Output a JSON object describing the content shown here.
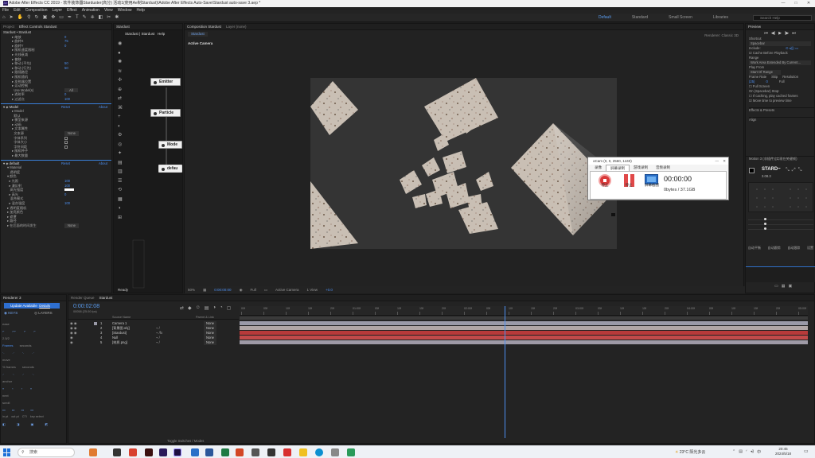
{
  "window": {
    "title": "Adobe After Effects CC 2019 - 软件装饰器Starduster(高分) 活动1(使用Ae制Stardust)\\Adobe After Effects Auto-Save\\Stardust auto-save 3.aep *",
    "controls": [
      "—",
      "□",
      "✕"
    ]
  },
  "menu": [
    "File",
    "Edit",
    "Composition",
    "Layer",
    "Effect",
    "Animation",
    "View",
    "Window",
    "Help"
  ],
  "workspaces": [
    "Default",
    "Standard",
    "Small Screen",
    "Libraries"
  ],
  "active_workspace": "Default",
  "search_placeholder": "Search Help",
  "project_panel": {
    "tabs": [
      "Project",
      "Effect Controls Stardust"
    ],
    "header": "Stardust • Stardust",
    "rows": [
      "缩放",
      "旋转X",
      "旋转Y",
      "随机速度限制",
      "光线衰减",
      "偏移",
      "移动 (平均)",
      "移动 (行为)",
      "跟随路径",
      "随机随机",
      "发射器位置",
      "运动控制",
      "Use Model(s)",
      "透射率",
      "过滤点",
      "Model",
      "默认",
      "模型来源",
      "动画",
      "文本属性",
      "文本源",
      "字体系列",
      "字体大小",
      "字符间距",
      "随机种子",
      "最大数量",
      "遮罩",
      "路径"
    ],
    "values": [
      "0",
      "75",
      "0",
      "50",
      "50",
      "All",
      "0",
      "100",
      "Reset About",
      "None"
    ],
    "section_model": "Model",
    "section_default": "default",
    "reset_label": "Reset",
    "about_label": "About",
    "material_rows": [
      "Material",
      "透明度",
      "颜色",
      "光照",
      "漫反射",
      "高光强度",
      "高光",
      "混合模式",
      "混合强度",
      "透明度随机",
      "加亮颜色"
    ],
    "material_values": [
      "100",
      "100",
      "0",
      "100",
      "100",
      "None"
    ],
    "footer": "在后面的时间发生",
    "footer_value": "None"
  },
  "stardust_panel": {
    "tab": "Stardust",
    "header": [
      "Stardust",
      "Stardust",
      "Help"
    ],
    "nodes": [
      "Emitter",
      "Particle",
      "Mode",
      "defau"
    ],
    "status": "Ready"
  },
  "comp_panel": {
    "tabs": [
      "Composition Stardust",
      "Layer (none)"
    ],
    "subtab": "Stardust",
    "camera_label": "Active Camera",
    "renderer": "Renderer: Classic 3D",
    "bottom_controls": [
      "50%",
      "0:00:00:00",
      "Full",
      "Active Camera",
      "1 View",
      "+0.0"
    ]
  },
  "ocam": {
    "title": "oCam (0, 0, 2560, 1440)",
    "tabs": [
      "录像",
      "屏幕录制",
      "游戏录制",
      "音频录制"
    ],
    "active_tab": "屏幕录制",
    "buttons": [
      "停止",
      "停止",
      "屏幕截图"
    ],
    "time": "00:00:00",
    "storage": "0bytes / 37.1GB"
  },
  "preview_panel": {
    "tab": "Preview",
    "shortcut_label": "Shortcut",
    "shortcut_value": "Spacebar",
    "include_label": "Include:",
    "cache_label": "Cache Before Playback",
    "range_label": "Range",
    "range_value": "Work Area Extended By Current...",
    "play_from_label": "Play From",
    "play_from_value": "Start Of Range",
    "frame_rate_label": "Frame Rate",
    "skip_label": "Skip",
    "resolution_label": "Resolution",
    "frame_rate_value": "(25)",
    "skip_value": "0",
    "resolution_value": "Full",
    "fullscreen_label": "Full Screen",
    "on_stop_label": "On (Spacebar) Stop:",
    "if_caching_label": "If caching, play cached frames",
    "move_time_label": "Move time to preview time",
    "effects_label": "Effects & Presets",
    "align_label": "Align"
  },
  "motion_panel": {
    "title": "Motion 3",
    "subtitle": "(非插件)(实现在关键帧)",
    "star_label": "STARD~",
    "version": "3.08.3",
    "buttons": [
      "自动平衡",
      "自动跟踪",
      "自动跟踪",
      "设置"
    ]
  },
  "left_timeline": {
    "tabs": [
      "Renderer 3",
      "Update Available"
    ],
    "update_label": "Update Available",
    "details_label": "Details",
    "keys_label": "KEYS",
    "layers_label": "LAYERS",
    "labels": [
      "ease",
      "2.5/2",
      "Frames",
      "seconds",
      "move",
      "% frames",
      "seconds",
      "anchor",
      "next",
      "scroll"
    ],
    "bottom": [
      "in pt",
      "out pt",
      "CTI",
      "key select"
    ]
  },
  "timeline": {
    "tabs": [
      "Render Queue",
      "Stardust"
    ],
    "timecode": "0:00:02:08",
    "fps": "00058 (25.00 fps)",
    "columns": [
      "Source Name",
      "Parent & Link"
    ],
    "layers": [
      {
        "num": "1",
        "name": "Camera 1",
        "parent": "None",
        "color": "#9a9aa8"
      },
      {
        "num": "2",
        "name": "[背景图.obj]",
        "parent": "None",
        "color": "#b0a6a6"
      },
      {
        "num": "3",
        "name": "[Stardust]",
        "parent": "None",
        "color": "#b83a3a"
      },
      {
        "num": "4",
        "name": "Null",
        "parent": "None",
        "color": "#c24a4a"
      },
      {
        "num": "5",
        "name": "[材质.png]",
        "parent": "None",
        "color": "#9e9aa6"
      }
    ],
    "ticks": [
      "00f",
      "05f",
      "10f",
      "15f",
      "20f",
      "01:00f",
      "05f",
      "10f",
      "15f",
      "20f",
      "02:00f",
      "05f",
      "10f",
      "15f",
      "20f",
      "03:00f",
      "05f",
      "10f",
      "15f",
      "20f",
      "04:00f",
      "05f",
      "10f",
      "15f",
      "20f",
      "05:00f"
    ],
    "playhead_fraction": 0.466,
    "toggle_label": "Toggle Switches / Modes"
  },
  "taskbar": {
    "search": "搜索",
    "weather": "23°C 阳光多云",
    "time": "20:45",
    "date": "2024/5/18"
  }
}
